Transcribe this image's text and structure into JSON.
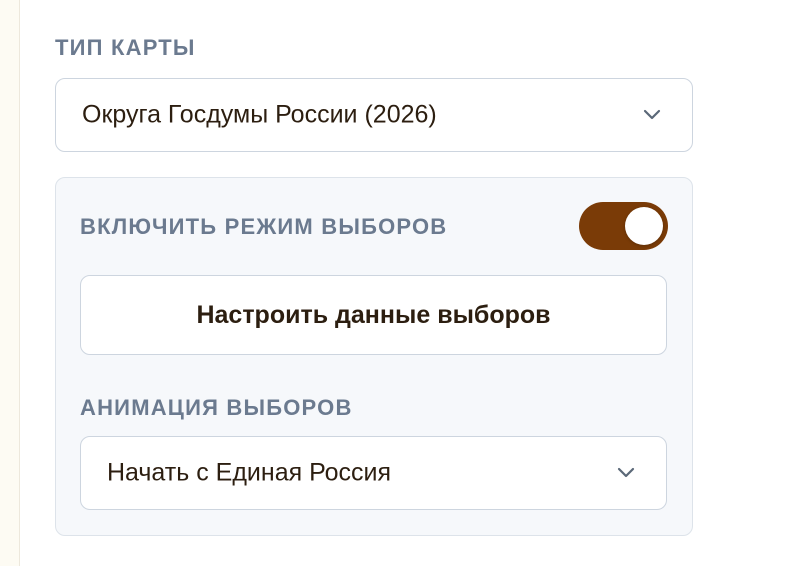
{
  "map_type": {
    "label": "ТИП КАРТЫ",
    "selected": "Округа Госдумы России (2026)",
    "icon": "chevron-down-icon"
  },
  "election_panel": {
    "toggle_label": "ВКЛЮЧИТЬ РЕЖИМ ВЫБОРОВ",
    "toggle_on": true,
    "toggle_color": "#7a3b07",
    "config_button_label": "Настроить данные выборов",
    "animation_label": "АНИМАЦИЯ ВЫБОРОВ",
    "animation_selected": "Начать с Единая Россия",
    "icon": "chevron-down-icon"
  }
}
